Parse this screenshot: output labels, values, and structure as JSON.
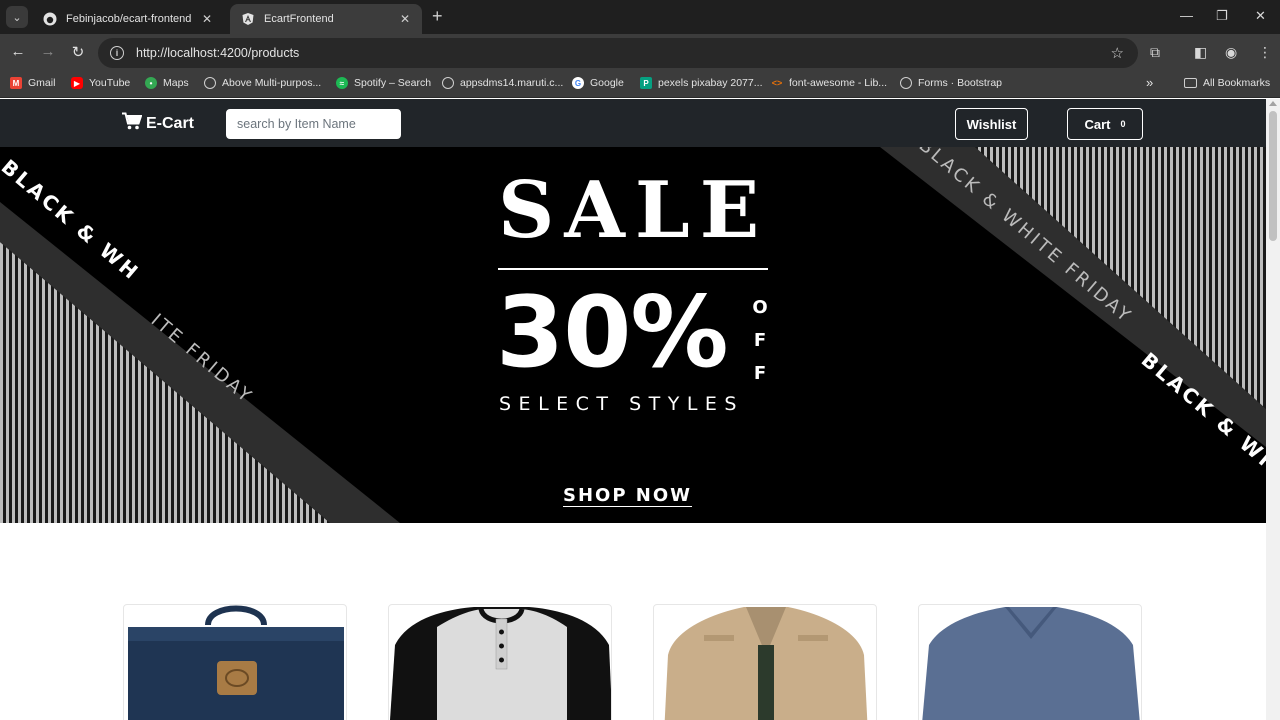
{
  "browser": {
    "tabs": [
      {
        "title": "Febinjacob/ecart-frontend",
        "favicon": "github-icon",
        "active": false
      },
      {
        "title": "EcartFrontend",
        "favicon": "angular-icon",
        "active": true
      }
    ],
    "url": "http://localhost:4200/products",
    "bookmarks": [
      {
        "label": "Gmail",
        "icon": "gmail-icon"
      },
      {
        "label": "YouTube",
        "icon": "youtube-icon"
      },
      {
        "label": "Maps",
        "icon": "maps-icon"
      },
      {
        "label": "Above Multi-purpos...",
        "icon": "globe-icon"
      },
      {
        "label": "Spotify – Search",
        "icon": "spotify-icon"
      },
      {
        "label": "appsdms14.maruti.c...",
        "icon": "globe-icon"
      },
      {
        "label": "Google",
        "icon": "google-icon"
      },
      {
        "label": "pexels pixabay 2077...",
        "icon": "pexels-icon"
      },
      {
        "label": "font-awesome - Lib...",
        "icon": "code-icon"
      },
      {
        "label": "Forms · Bootstrap",
        "icon": "globe-icon"
      }
    ],
    "all_bookmarks": "All Bookmarks",
    "more_bookmarks": "»"
  },
  "navbar": {
    "brand": "E-Cart",
    "search_placeholder": "search by Item Name",
    "wishlist_label": "Wishlist",
    "cart_label": "Cart",
    "cart_count": "0"
  },
  "banner": {
    "sale": "SALE",
    "percent": "30%",
    "off": [
      "O",
      "F",
      "F"
    ],
    "subtitle": "SELECT STYLES",
    "cta": "SHOP NOW",
    "stripe_text_left_bold": "BLACK & WH",
    "stripe_text_left_light": "ITE FRIDAY",
    "stripe_text_left_bold2": "BLACK & WHITE FRIDAY BLACK &",
    "stripe_text_right_light": "BLACK & WHITE FRIDAY",
    "stripe_text_right_bold": "BLACK & WH"
  },
  "products": [
    {
      "name": "navy-backpack"
    },
    {
      "name": "raglan-henley-shirt"
    },
    {
      "name": "khaki-jacket"
    },
    {
      "name": "blue-vneck-tshirt"
    }
  ],
  "colors": {
    "navbar_bg": "#212529",
    "banner_bg": "#000000",
    "chrome_bg": "#3c3c3c"
  }
}
